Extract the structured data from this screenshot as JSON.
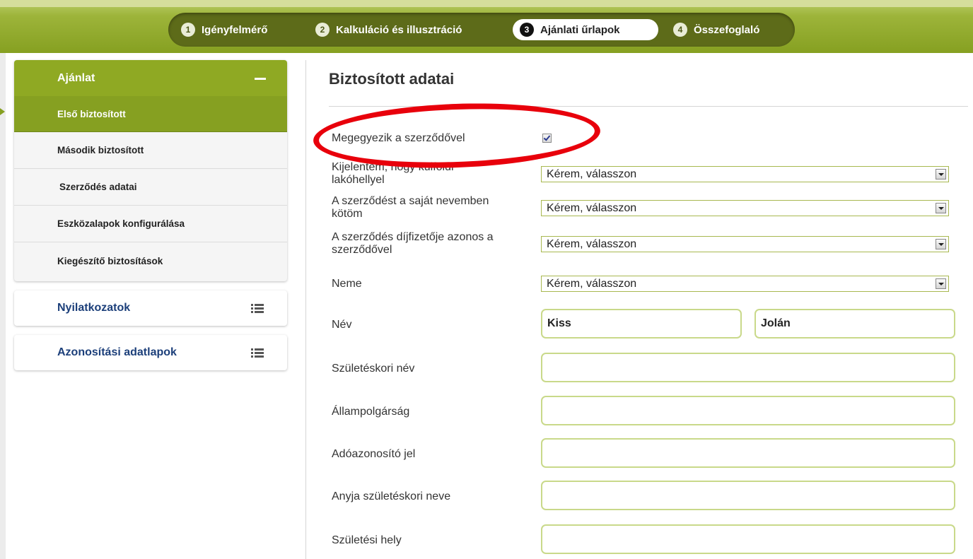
{
  "wizard": {
    "steps": [
      {
        "num": "1",
        "label": "Igényfelmérő"
      },
      {
        "num": "2",
        "label": "Kalkuláció és illusztráció"
      },
      {
        "num": "3",
        "label": "Ajánlati űrlapok"
      },
      {
        "num": "4",
        "label": "Összefoglaló"
      }
    ],
    "active_step": 3
  },
  "sidebar": {
    "section_title": "Ajánlat",
    "items": [
      {
        "label": "Első biztosított",
        "active": true
      },
      {
        "label": "Második biztosított"
      },
      {
        "label": "Szerződés adatai"
      },
      {
        "label": "Eszközalapok konfigurálása"
      },
      {
        "label": "Kiegészítő biztosítások"
      }
    ],
    "cards": [
      {
        "label": "Nyilatkozatok",
        "icon": "list-icon"
      },
      {
        "label": "Azonosítási adatlapok",
        "icon": "list-icon"
      }
    ]
  },
  "form": {
    "title": "Biztosított adatai",
    "same_as_contract": {
      "label": "Megegyezik a szerződővel",
      "checked": true
    },
    "selects": [
      {
        "label_line1": "Kijelentem, hogy külföldi",
        "label_line2": "lakóhellyel",
        "value": "Kérem, válasszon"
      },
      {
        "label_line1": "A szerződést a saját nevemben",
        "label_line2": "kötöm",
        "value": "Kérem, válasszon"
      },
      {
        "label_line1": "A szerződés díjfizetője azonos a",
        "label_line2": "szerződővel",
        "value": "Kérem, válasszon"
      },
      {
        "label_line1": "Neme",
        "label_line2": "",
        "value": "Kérem, válasszon"
      }
    ],
    "name": {
      "label": "Név",
      "last": "Kiss",
      "first": "Jolán"
    },
    "fields": [
      {
        "label": "Születéskori név",
        "value": ""
      },
      {
        "label": "Állampolgárság",
        "value": ""
      },
      {
        "label": "Adóazonosító jel",
        "value": ""
      },
      {
        "label": "Anyja születéskori neve",
        "value": ""
      },
      {
        "label": "Születési hely",
        "value": ""
      }
    ]
  },
  "colors": {
    "accent": "#86a021",
    "dark_olive": "#5d6b19",
    "annotation": "#e8000b",
    "link": "#1c3f7a"
  }
}
